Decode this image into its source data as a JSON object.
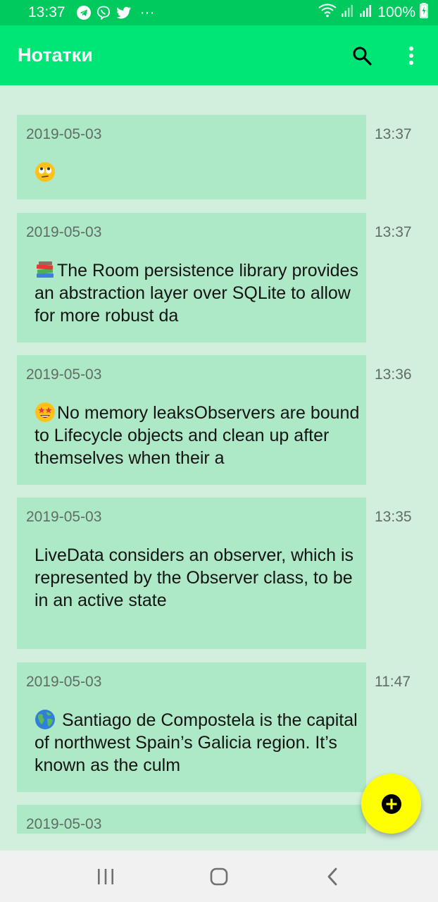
{
  "status_bar": {
    "time": "13:37",
    "dots": "···",
    "battery_text": "100%",
    "icons": [
      "telegram-icon",
      "viber-icon",
      "twitter-icon",
      "wifi-icon",
      "signal-icon",
      "signal-icon",
      "battery-charging-icon"
    ]
  },
  "app_bar": {
    "title": "Нотатки",
    "actions": [
      "search-icon",
      "more-vert-icon"
    ]
  },
  "notes": [
    {
      "date": "2019-05-03",
      "time": "13:37",
      "emoji": "face-with-rolling-eyes-emoji",
      "text": ""
    },
    {
      "date": "2019-05-03",
      "time": "13:37",
      "emoji": "books-emoji",
      "text": "The Room persistence library provides an abstraction layer over SQLite to allow for more robust da"
    },
    {
      "date": "2019-05-03",
      "time": "13:36",
      "emoji": "star-struck-emoji",
      "text": "No memory leaksObservers are bound to Lifecycle objects and clean up after themselves when their a"
    },
    {
      "date": "2019-05-03",
      "time": "13:35",
      "emoji": "",
      "text": "LiveData considers an observer, which is represented by the Observer class, to be in an active state"
    },
    {
      "date": "2019-05-03",
      "time": "11:47",
      "emoji": "globe-emoji",
      "text": " Santiago de Compostela is the capital of northwest Spain’s Galicia region. It’s known as the culm"
    },
    {
      "date": "2019-05-03",
      "time": "",
      "emoji": "",
      "text": ""
    }
  ],
  "fab": {
    "icon": "add-icon"
  },
  "nav_bar": {
    "icons": [
      "recent-apps-icon",
      "home-icon",
      "back-icon"
    ]
  },
  "colors": {
    "status_bar": "#00c95d",
    "app_bar": "#00e676",
    "background": "#d2efdd",
    "card": "#aee9c7",
    "fab": "#ffff00"
  }
}
